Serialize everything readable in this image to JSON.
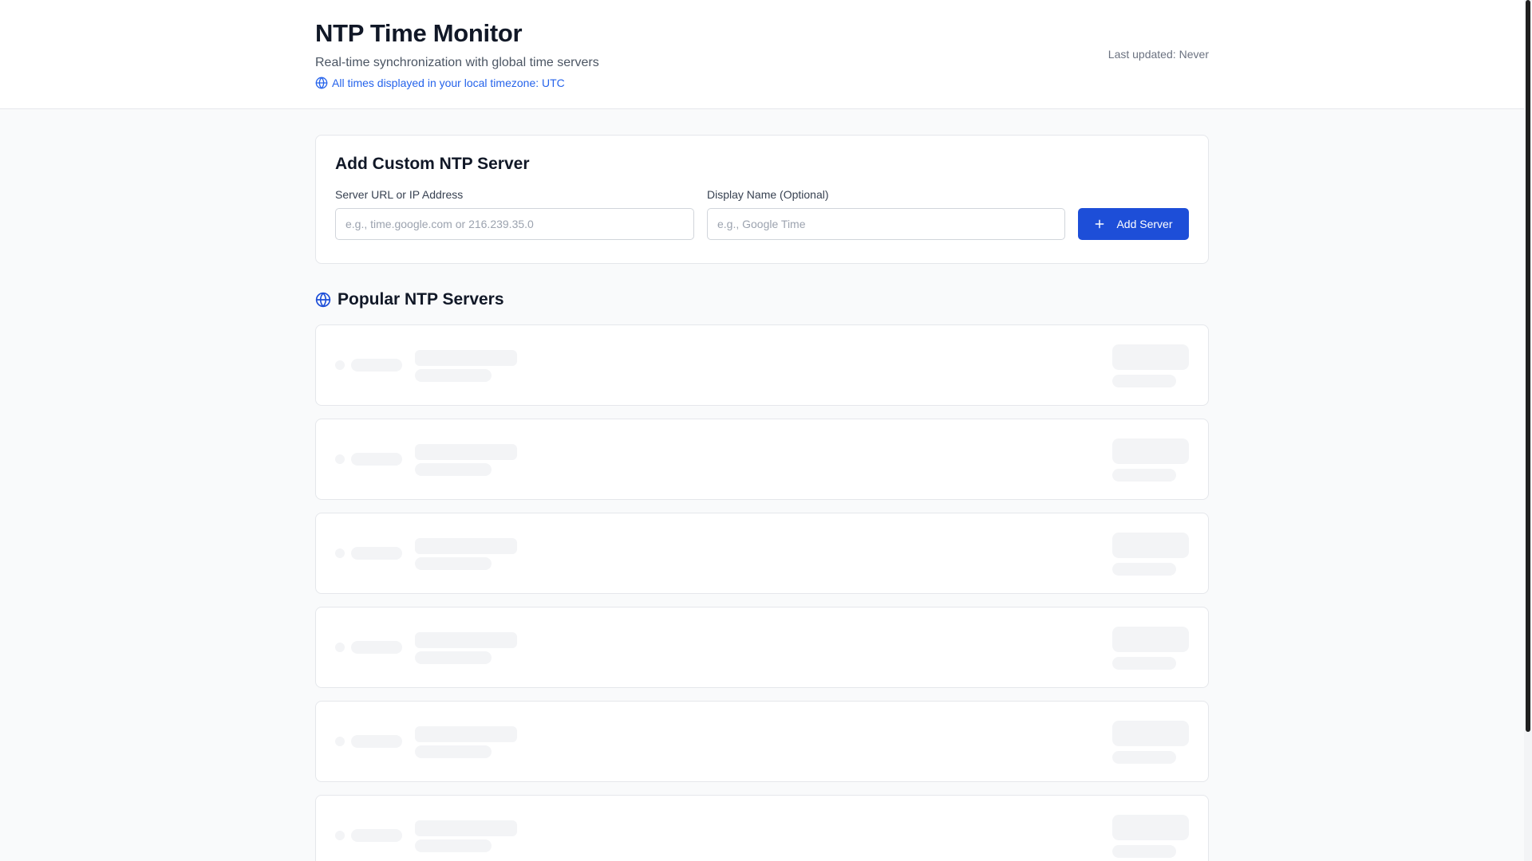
{
  "header": {
    "title": "NTP Time Monitor",
    "subtitle": "Real-time synchronization with global time servers",
    "timezone_note": "All times displayed in your local timezone: UTC",
    "last_updated_label": "Last updated:",
    "last_updated_value": "Never"
  },
  "add_server": {
    "title": "Add Custom NTP Server",
    "url_label": "Server URL or IP Address",
    "url_placeholder": "e.g., time.google.com or 216.239.35.0",
    "url_value": "",
    "name_label": "Display Name (Optional)",
    "name_placeholder": "e.g., Google Time",
    "name_value": "",
    "button_label": "Add Server"
  },
  "popular": {
    "title": "Popular NTP Servers",
    "loading_placeholder_count": 6
  },
  "icons": {
    "timezone": "globe-icon",
    "section": "globe-icon",
    "add": "plus-icon"
  },
  "colors": {
    "accent": "#1d4ed8",
    "link": "#2563eb",
    "skeleton": "#f3f4f6"
  }
}
